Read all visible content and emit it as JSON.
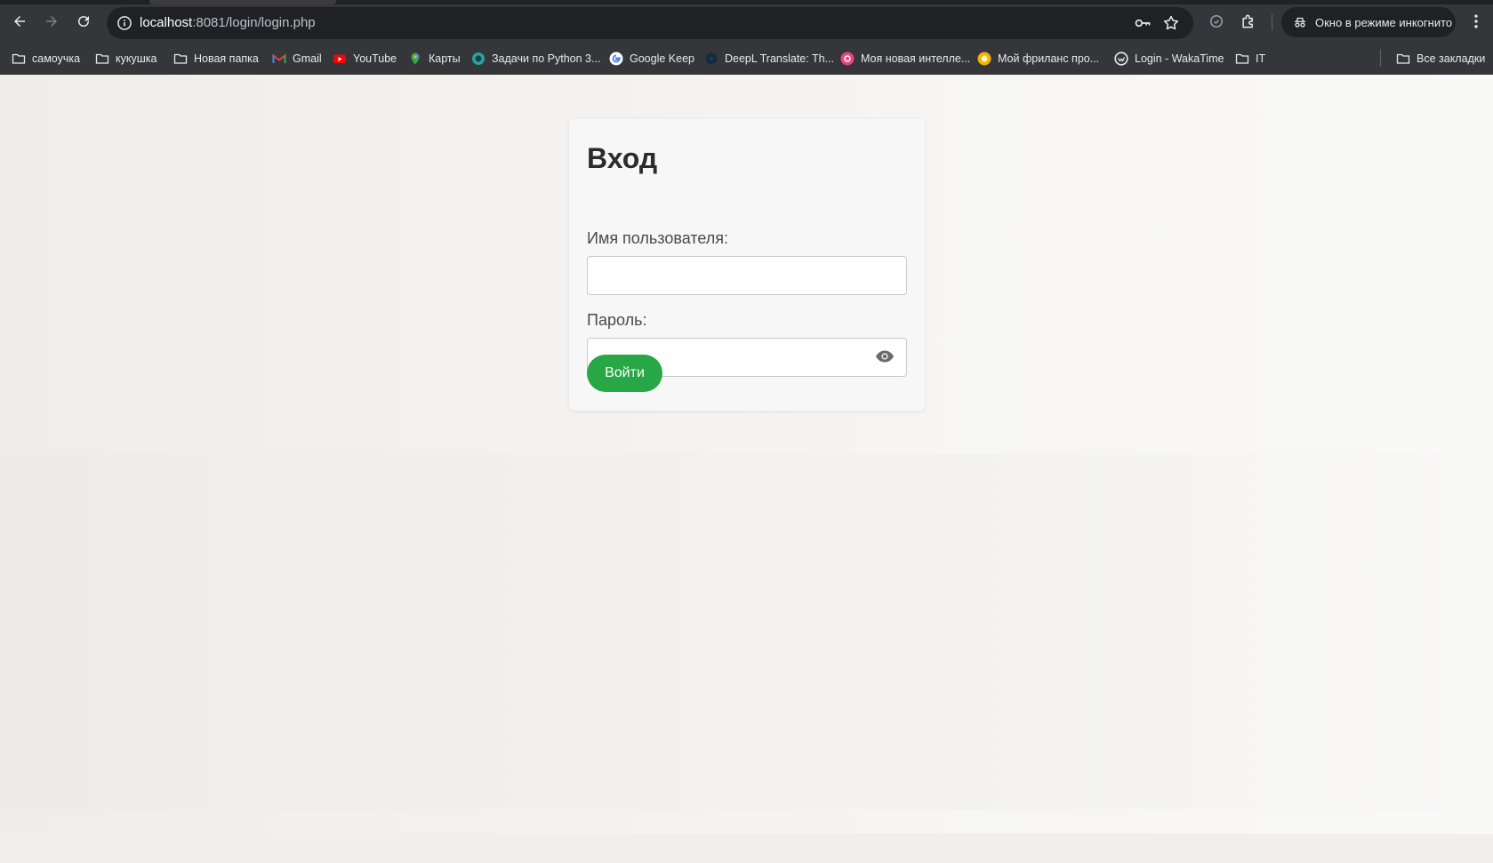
{
  "browser": {
    "url_host": "localhost",
    "url_path": ":8081/login/login.php",
    "incognito_label": "Окно в режиме инкогнито"
  },
  "bookmarks": [
    {
      "label": "самоучка",
      "icon": "folder-icon"
    },
    {
      "label": "кукушка",
      "icon": "folder-icon"
    },
    {
      "label": "Новая папка",
      "icon": "folder-icon"
    },
    {
      "label": "Gmail",
      "icon": "gmail-icon"
    },
    {
      "label": "YouTube",
      "icon": "youtube-icon"
    },
    {
      "label": "Карты",
      "icon": "maps-icon"
    },
    {
      "label": "Задачи по Python 3...",
      "icon": "python-tasks-icon"
    },
    {
      "label": "Google Keep",
      "icon": "google-icon"
    },
    {
      "label": "DeepL Translate: Th...",
      "icon": "deepl-icon"
    },
    {
      "label": "Моя новая интелле...",
      "icon": "ai-app-icon"
    },
    {
      "label": "Мой фриланс про...",
      "icon": "freelance-icon"
    },
    {
      "label": "Login - WakaTime",
      "icon": "wakatime-icon"
    },
    {
      "label": "IT",
      "icon": "folder-icon"
    },
    {
      "label": "Все закладки",
      "icon": "folder-icon"
    }
  ],
  "login": {
    "title": "Вход",
    "username_label": "Имя пользователя:",
    "username_value": "",
    "password_label": "Пароль:",
    "password_value": "",
    "submit_label": "Войти"
  },
  "colors": {
    "accent": "#27a745",
    "chrome": "#35363a",
    "omnibox": "#202124"
  }
}
